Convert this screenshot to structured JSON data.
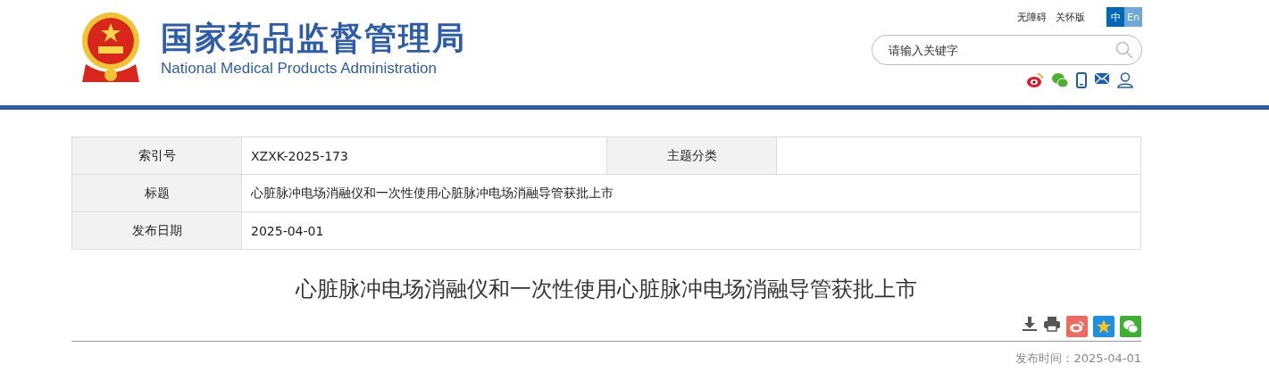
{
  "header": {
    "title": "国家药品监督管理局",
    "subtitle": "National Medical Products Administration",
    "links": [
      "无障碍",
      "关怀版"
    ],
    "languages": [
      {
        "label": "中",
        "selected": true
      },
      {
        "label": "En",
        "selected": false
      }
    ],
    "search": {
      "placeholder": "请输入关键字"
    },
    "social": [
      {
        "kind": "weibo"
      },
      {
        "kind": "wechat"
      },
      {
        "kind": "phone"
      },
      {
        "kind": "mail"
      },
      {
        "kind": "user"
      }
    ]
  },
  "info_table": {
    "rows": [
      {
        "cells": [
          {
            "kind": "label",
            "text": "索引号"
          },
          {
            "kind": "value",
            "text": "XZXK-2025-173"
          },
          {
            "kind": "label",
            "text": "主题分类"
          }
        ]
      },
      {
        "cells": [
          {
            "kind": "label",
            "text": "标题"
          },
          {
            "kind": "value",
            "text": "心脏脉冲电场消融仪和一次性使用心脏脉冲电场消融导管获批上市"
          }
        ]
      },
      {
        "cells": [
          {
            "kind": "label",
            "text": "发布日期"
          },
          {
            "kind": "value",
            "text": "2025-04-01"
          }
        ]
      }
    ]
  },
  "article": {
    "title": "心脏脉冲电场消融仪和一次性使用心脏脉冲电场消融导管获批上市",
    "tools": [
      {
        "kind": "download"
      },
      {
        "kind": "print"
      },
      {
        "kind": "weibo"
      },
      {
        "kind": "qzone"
      },
      {
        "kind": "wechat"
      }
    ],
    "published": "发布时间：2025-04-01"
  }
}
